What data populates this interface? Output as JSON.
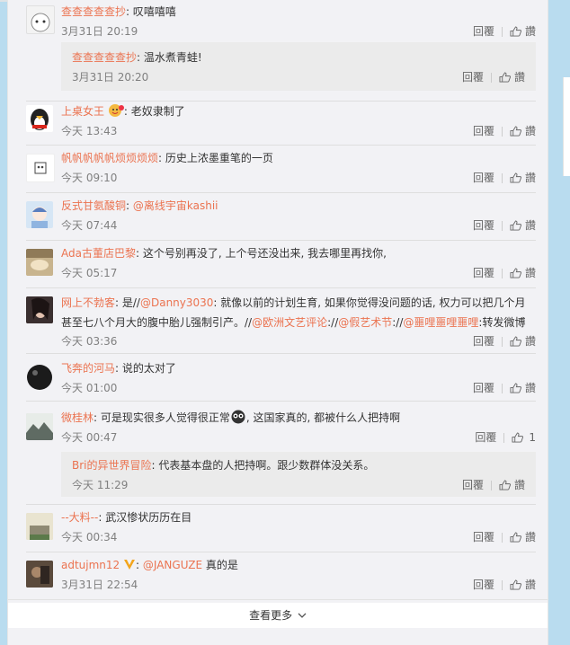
{
  "actions": {
    "reply": "回覆",
    "like": "讚"
  },
  "comments": [
    {
      "user": "查查查查查抄",
      "text": "叹嘻嘻嘻",
      "time": "3月31日 20:19",
      "reply": {
        "user": "查查查查查抄",
        "text": "温水煮青蛙!",
        "time": "3月31日 20:20"
      }
    },
    {
      "user": "上桌女王",
      "text": "老奴隶制了",
      "time": "今天 13:43"
    },
    {
      "user": "帆帆帆帆帆烦烦烦烦",
      "text": "历史上浓墨重笔的一页",
      "time": "今天 09:10"
    },
    {
      "user": "反式甘氨酸铜",
      "mention": "@离线宇宙kashii",
      "time": "今天 07:44"
    },
    {
      "user": "Ada古董店巴黎",
      "text": "这个号别再没了, 上个号还没出来, 我去哪里再找你,",
      "time": "今天 05:17"
    },
    {
      "user": "网上不勃客",
      "p1": "是//",
      "m1": "@Danny3030",
      "p2": ": 就像以前的计划生育, 如果你觉得没问题的话, 权力可以把几个月",
      "p3": "甚至七八个月大的腹中胎儿强制引产。//",
      "m2": "@欧洲文艺评论",
      "p4": "://",
      "m3": "@假艺术节",
      "p5": "://",
      "m4": "@噩哩噩哩噩哩",
      "p6": ":转发微博",
      "time": "今天 03:36"
    },
    {
      "user": "飞奔的河马",
      "text": "说的太对了",
      "time": "今天 01:00"
    },
    {
      "user": "微桂林",
      "text": "可是现实很多人觉得很正常",
      "text2": ", 这国家真的, 都被什么人把持啊",
      "time": "今天 00:47",
      "like_count": "1",
      "reply": {
        "user": "Bri的异世界冒险",
        "text": "代表基本盘的人把持啊。跟少数群体没关系。",
        "time": "今天 11:29"
      }
    },
    {
      "user": "--大料--",
      "text": "武汉惨状历历在目",
      "time": "今天 00:34"
    },
    {
      "user": "adtujmn12",
      "mention": "@JANGUZE",
      "text": " 真的是",
      "time": "3月31日 22:54"
    }
  ],
  "more": {
    "label": "查看更多",
    "icon": "chevron-down-icon"
  },
  "colors": {
    "username": "#eb7350",
    "background": "#b9dcef",
    "list_bg": "#f2f2f5"
  }
}
